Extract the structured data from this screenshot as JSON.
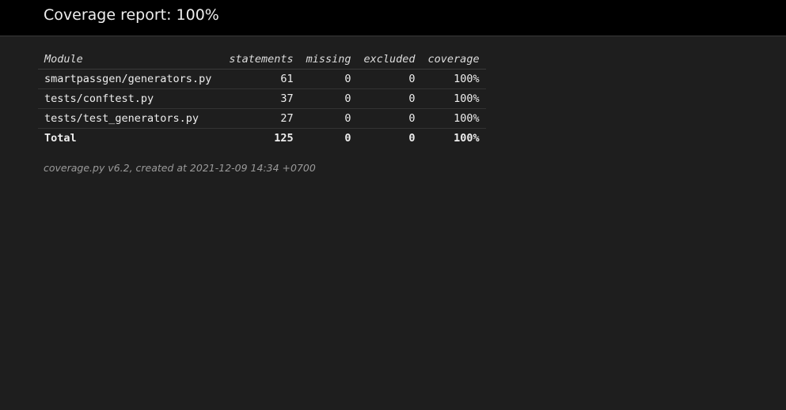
{
  "header": {
    "title": "Coverage report: 100%"
  },
  "table": {
    "columns": {
      "module": "Module",
      "statements": "statements",
      "missing": "missing",
      "excluded": "excluded",
      "coverage": "coverage"
    },
    "rows": [
      {
        "module": "smartpassgen/generators.py",
        "statements": "61",
        "missing": "0",
        "excluded": "0",
        "coverage": "100%"
      },
      {
        "module": "tests/conftest.py",
        "statements": "37",
        "missing": "0",
        "excluded": "0",
        "coverage": "100%"
      },
      {
        "module": "tests/test_generators.py",
        "statements": "27",
        "missing": "0",
        "excluded": "0",
        "coverage": "100%"
      }
    ],
    "total": {
      "label": "Total",
      "statements": "125",
      "missing": "0",
      "excluded": "0",
      "coverage": "100%"
    }
  },
  "footer": {
    "text": "coverage.py v6.2, created at 2021-12-09 14:34 +0700"
  }
}
